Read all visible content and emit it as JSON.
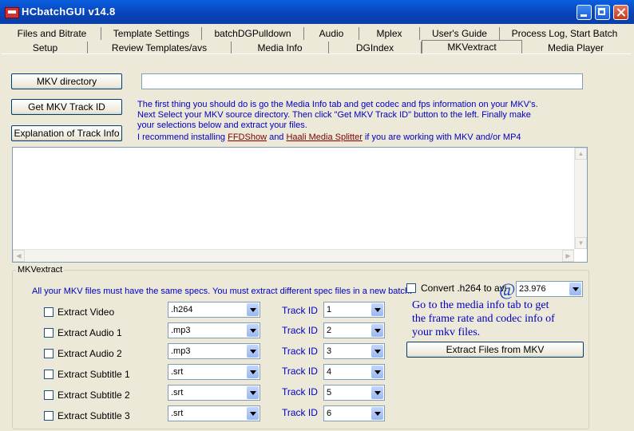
{
  "window": {
    "title": "HCbatchGUI v14.8"
  },
  "tabs_row1": [
    {
      "label": "Files and  Bitrate"
    },
    {
      "label": "Template Settings"
    },
    {
      "label": "batchDGPulldown"
    },
    {
      "label": "Audio"
    },
    {
      "label": "Mplex"
    },
    {
      "label": "User's Guide"
    },
    {
      "label": "Process Log, Start Batch"
    }
  ],
  "tabs_row2": [
    {
      "label": "Setup"
    },
    {
      "label": "Review Templates/avs"
    },
    {
      "label": "Media Info"
    },
    {
      "label": "DGIndex"
    },
    {
      "label": "MKVextract"
    },
    {
      "label": "Media Player"
    }
  ],
  "top": {
    "mkv_dir_button": "MKV directory",
    "mkv_dir_value": "",
    "get_track_button": "Get MKV Track ID",
    "explain_button": "Explanation of Track Info"
  },
  "info": {
    "line1": "The first thing you should do is go the Media Info tab and get codec and fps information on your MKV's.",
    "line2": "Next Select your MKV source directory.  Then click \"Get MKV Track ID\" button to the left.  Finally make",
    "line3": "your selections below and extract your files.",
    "line4_pre": "I recommend installing ",
    "link1": "FFDShow",
    "line4_mid": " and ",
    "link2": "Haali Media Splitter",
    "line4_post": " if you are working with MKV and/or MP4"
  },
  "group": {
    "label": "MKVextract",
    "note": "All your MKV files must have the same specs.  You must extract different spec files in a new batch.",
    "convert_label": "Convert .h264 to avi",
    "fps_value": "23.976",
    "at_symbol": "@",
    "hint_line1": "Go to the media info tab to get",
    "hint_line2": "the frame rate and codec info of",
    "hint_line3": "your  mkv files.",
    "extract_button": "Extract Files from MKV",
    "track_id_label": "Track ID",
    "rows": [
      {
        "label": "Extract Video",
        "format": ".h264",
        "track": "1"
      },
      {
        "label": "Extract Audio 1",
        "format": ".mp3",
        "track": "2"
      },
      {
        "label": "Extract Audio 2",
        "format": ".mp3",
        "track": "3"
      },
      {
        "label": "Extract Subtitle 1",
        "format": ".srt",
        "track": "4"
      },
      {
        "label": "Extract Subtitle 2",
        "format": ".srt",
        "track": "5"
      },
      {
        "label": "Extract Subtitle 3",
        "format": ".srt",
        "track": "6"
      }
    ]
  }
}
